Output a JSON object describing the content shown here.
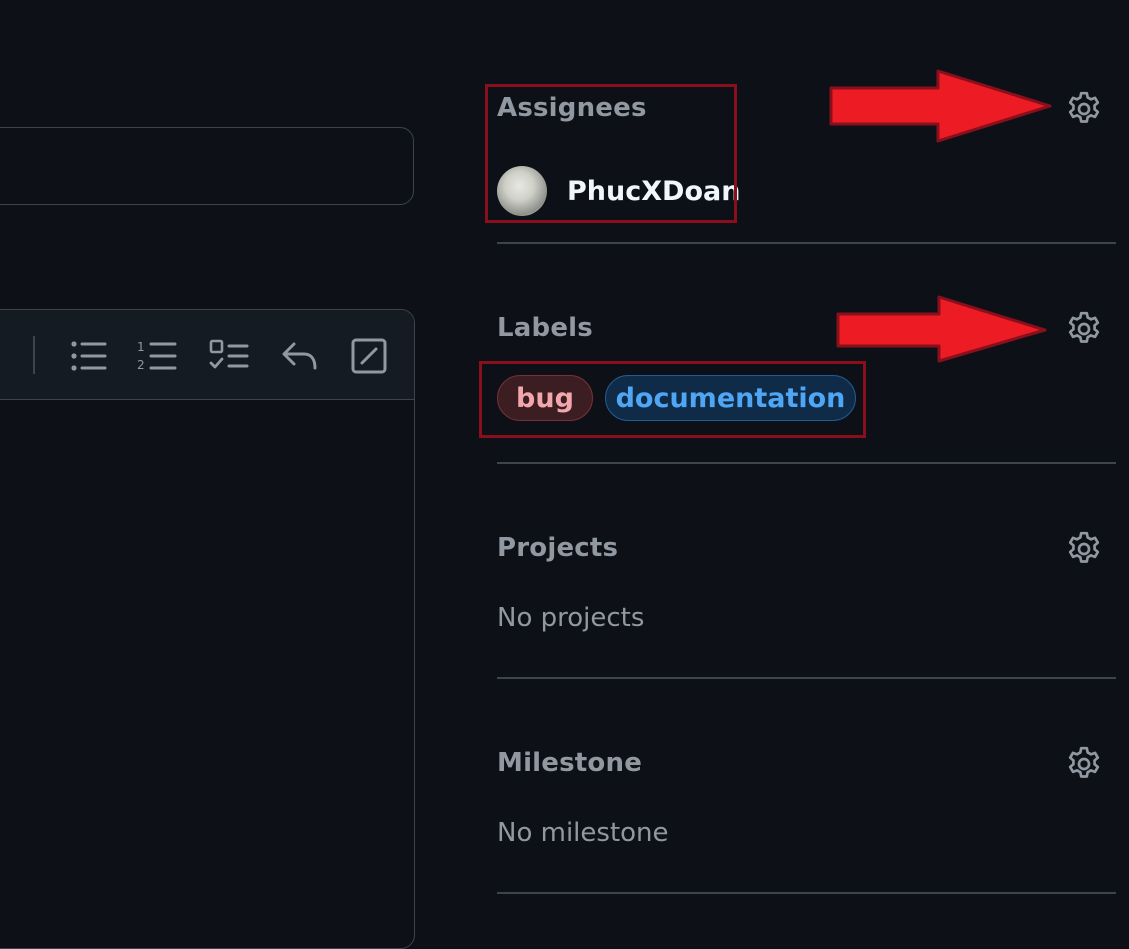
{
  "sidebar": {
    "assignees": {
      "heading": "Assignees",
      "users": [
        {
          "name": "PhucXDoan"
        }
      ]
    },
    "labels": {
      "heading": "Labels",
      "items": [
        {
          "name": "bug",
          "color": "#f2a7ad"
        },
        {
          "name": "documentation",
          "color": "#4fa6f5"
        }
      ]
    },
    "projects": {
      "heading": "Projects",
      "empty_text": "No projects"
    },
    "milestone": {
      "heading": "Milestone",
      "empty_text": "No milestone"
    }
  },
  "editor_toolbar": {
    "icons": [
      "unordered-list-icon",
      "ordered-list-icon",
      "task-list-icon",
      "reply-icon",
      "slash-command-icon"
    ]
  },
  "colors": {
    "background": "#0d1117",
    "border": "#3d444d",
    "annotation_red": "#ed1c24"
  }
}
